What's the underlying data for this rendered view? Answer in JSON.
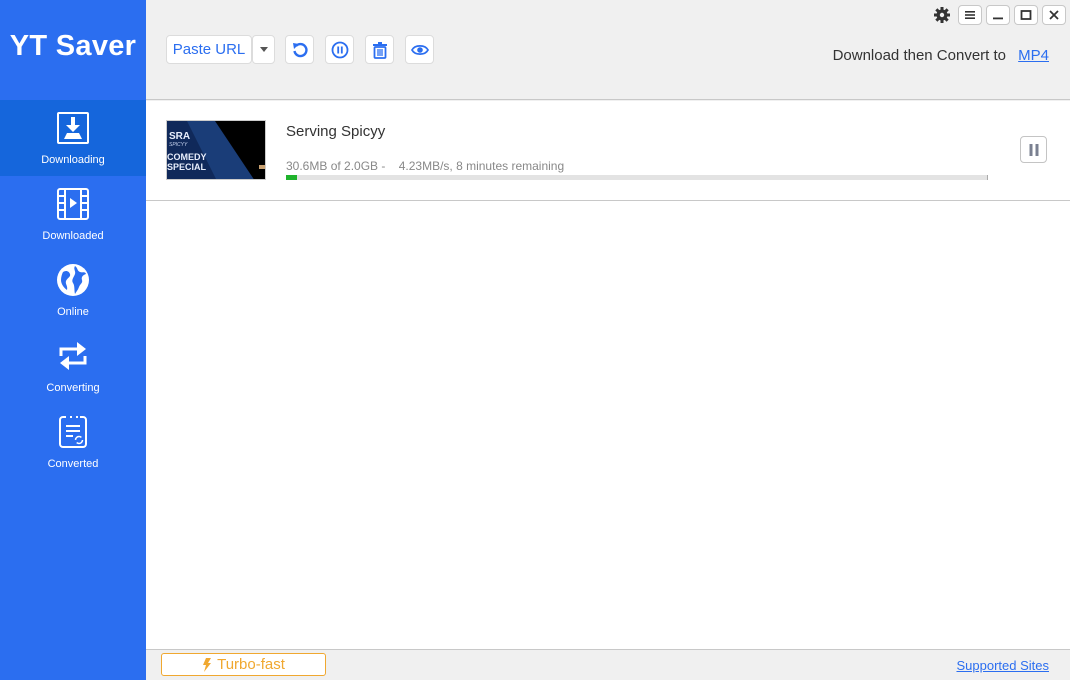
{
  "app": {
    "title": "YT Saver"
  },
  "colors": {
    "brand": "#2b6ef0",
    "active_nav": "#1566dc",
    "progress": "#1fb32c",
    "turbo": "#f0a830"
  },
  "sidebar": {
    "items": [
      {
        "label": "Downloading",
        "icon": "download-icon",
        "active": true
      },
      {
        "label": "Downloaded",
        "icon": "film-icon",
        "active": false
      },
      {
        "label": "Online",
        "icon": "globe-icon",
        "active": false
      },
      {
        "label": "Converting",
        "icon": "convert-arrows-icon",
        "active": false
      },
      {
        "label": "Converted",
        "icon": "converted-doc-icon",
        "active": false
      }
    ]
  },
  "toolbar": {
    "paste_url_label": "Paste URL",
    "convert_label": "Download then Convert to",
    "convert_format": "MP4",
    "icons": [
      "refresh-icon",
      "pause-all-icon",
      "trash-icon",
      "eye-icon"
    ]
  },
  "window_controls": [
    "gear-icon",
    "menu-icon",
    "minimize-icon",
    "maximize-icon",
    "close-icon"
  ],
  "downloads": [
    {
      "title": "Serving Spicyy",
      "thumb_text": [
        "SRA",
        "SPICYY",
        "COMEDY",
        "SPECIAL"
      ],
      "size_info": "30.6MB of 2.0GB -",
      "speed_info": "4.23MB/s, 8 minutes remaining",
      "progress_fraction": 0.015
    }
  ],
  "footer": {
    "turbo_label": "Turbo-fast",
    "supported_sites_label": "Supported Sites"
  }
}
